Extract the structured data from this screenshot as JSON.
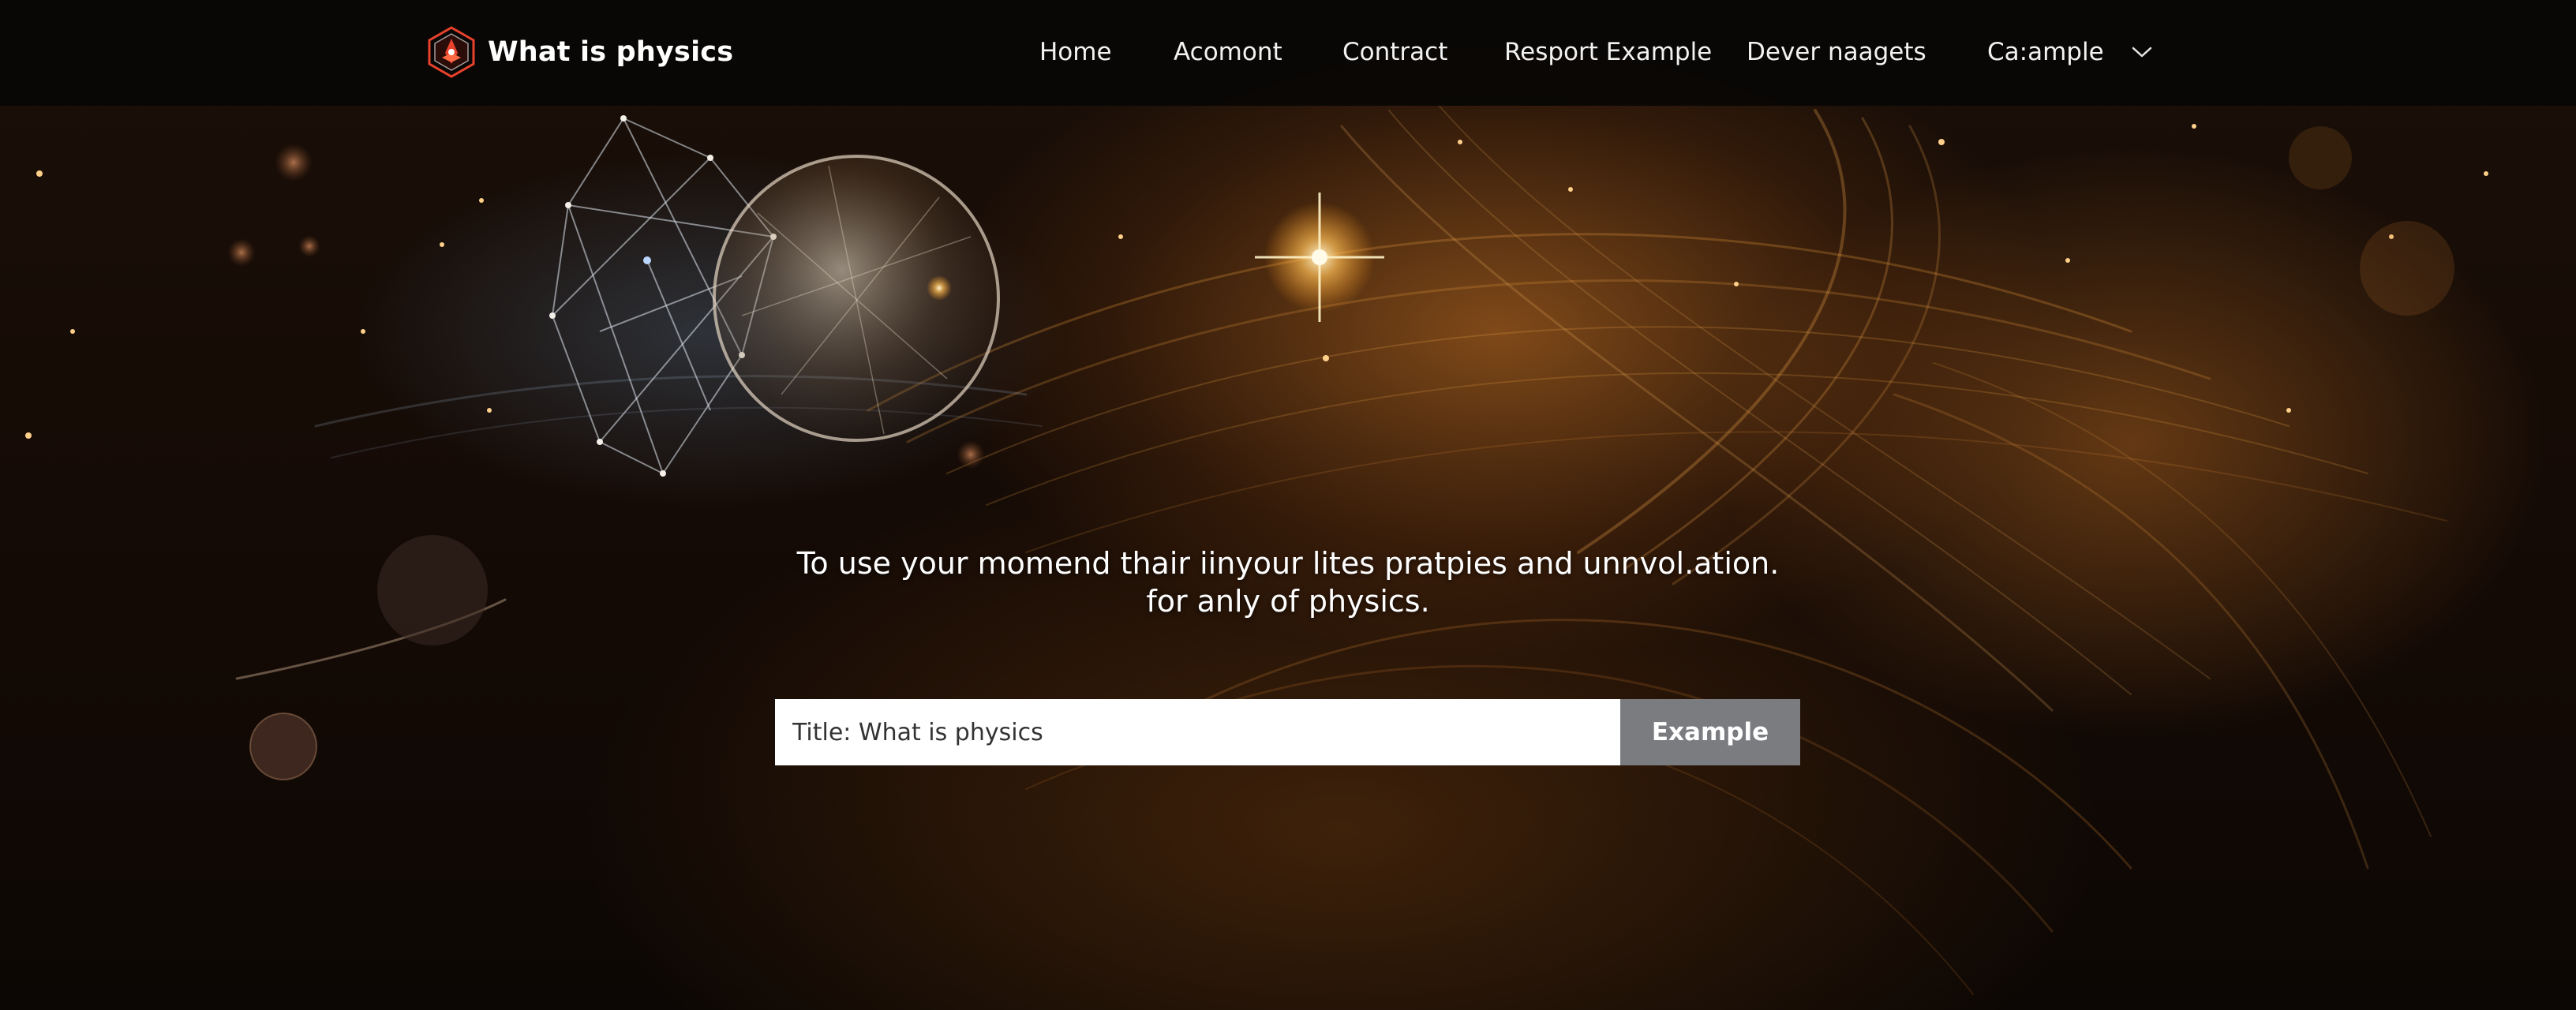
{
  "brand": {
    "name": "What is physics"
  },
  "nav": {
    "items": [
      {
        "label": "Home"
      },
      {
        "label": "Acomont"
      },
      {
        "label": "Contract"
      },
      {
        "label": "Resport Example"
      },
      {
        "label": "Dever naagets"
      }
    ],
    "dropdown": {
      "label": "Ca:ample",
      "icon": "chevron-down-icon"
    }
  },
  "hero": {
    "line1": "To use your momend thair iinyour lites pratpies and unnvol.ation.",
    "line2": "for anly of physics."
  },
  "search": {
    "value": "Title: What is physics",
    "button_label": "Example"
  },
  "colors": {
    "accent_orange": "#d67c28",
    "logo_red": "#e8412c",
    "button_gray": "#7a7c80",
    "nav_background": "#080605"
  }
}
